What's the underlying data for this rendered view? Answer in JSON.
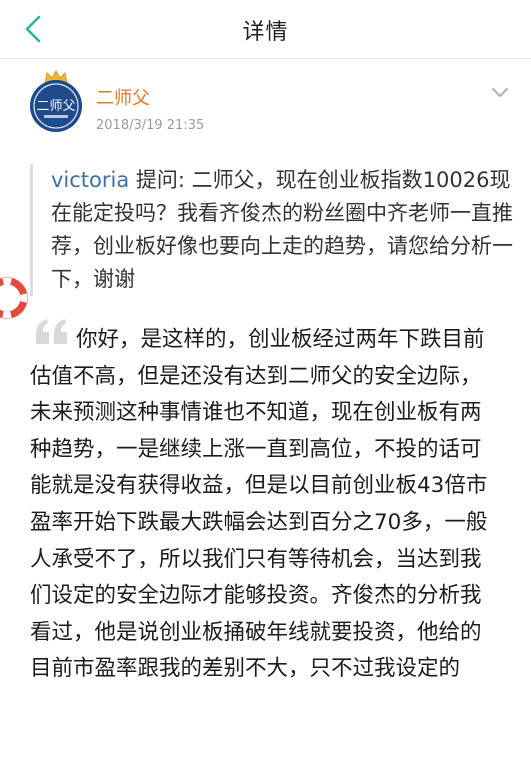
{
  "nav": {
    "title": "详情"
  },
  "author": {
    "name": "二师父",
    "avatar_text": "二师父",
    "post_time": "2018/3/19 21:35"
  },
  "question": {
    "user": "victoria",
    "prefix": " 提问: ",
    "text": "二师父，现在创业板指数10026现在能定投吗？我看齐俊杰的粉丝圈中齐老师一直推荐，创业板好像也要向上走的趋势，请您给分析一下，谢谢"
  },
  "answer": {
    "text": "你好，是这样的，创业板经过两年下跌目前估值不高，但是还没有达到二师父的安全边际，未来预测这种事情谁也不知道，现在创业板有两种趋势，一是继续上涨一直到高位，不投的话可能就是没有获得收益，但是以目前创业板43倍市盈率开始下跌最大跌幅会达到百分之70多，一般人承受不了，所以我们只有等待机会，当达到我们设定的安全边际才能够投资。齐俊杰的分析我看过，他是说创业板捅破年线就要投资，他给的目前市盈率跟我的差别不大，只不过我设定的"
  },
  "colors": {
    "accent": "#2bb5a0",
    "author_name": "#e07b24",
    "question_user": "#3d6fa8",
    "float_ring": "#e24a3b"
  }
}
